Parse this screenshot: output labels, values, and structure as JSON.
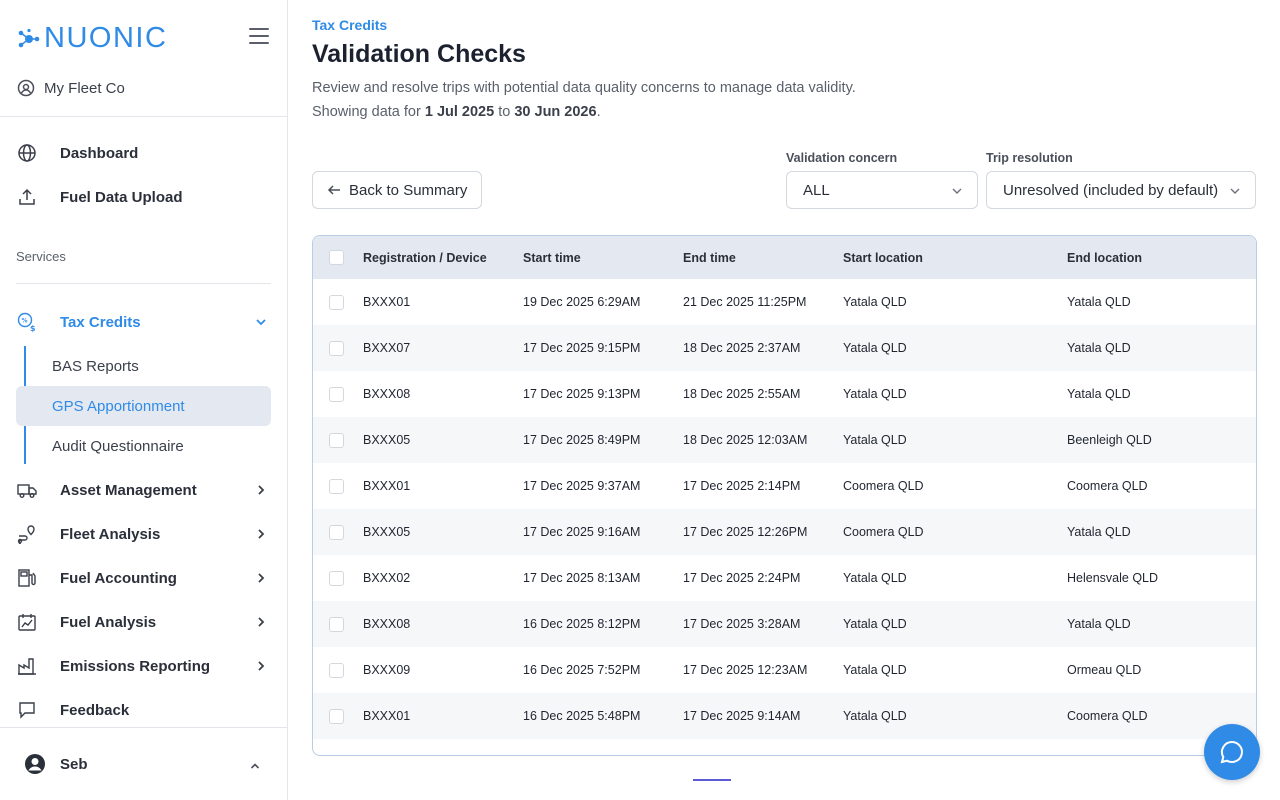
{
  "brand": {
    "name": "NUONIC"
  },
  "org": {
    "name": "My Fleet Co"
  },
  "nav_top": [
    {
      "label": "Dashboard",
      "icon": "globe-icon"
    },
    {
      "label": "Fuel Data Upload",
      "icon": "upload-icon"
    }
  ],
  "services_label": "Services",
  "tax_credits": {
    "label": "Tax Credits",
    "icon": "tax-credits-icon",
    "children": [
      {
        "label": "BAS Reports",
        "selected": false
      },
      {
        "label": "GPS Apportionment",
        "selected": true
      },
      {
        "label": "Audit Questionnaire",
        "selected": false
      }
    ]
  },
  "nav_services": [
    {
      "label": "Asset Management",
      "icon": "truck-icon"
    },
    {
      "label": "Fleet Analysis",
      "icon": "route-pin-icon"
    },
    {
      "label": "Fuel Accounting",
      "icon": "fuel-pump-icon"
    },
    {
      "label": "Fuel Analysis",
      "icon": "calendar-chart-icon"
    },
    {
      "label": "Emissions Reporting",
      "icon": "factory-icon"
    }
  ],
  "feedback": {
    "label": "Feedback",
    "icon": "chat-bubble-icon"
  },
  "user": {
    "name": "Seb"
  },
  "page": {
    "breadcrumb": "Tax Credits",
    "title": "Validation Checks",
    "description": "Review and resolve trips with potential data quality concerns to manage data validity.",
    "showing_prefix": "Showing data for ",
    "date_from": "1 Jul 2025",
    "showing_to": " to ",
    "date_to": "30 Jun 2026",
    "showing_suffix": "."
  },
  "controls": {
    "back_label": "Back to Summary",
    "validation_concern": {
      "label": "Validation concern",
      "value": "ALL"
    },
    "trip_resolution": {
      "label": "Trip resolution",
      "value": "Unresolved (included by default)"
    }
  },
  "table": {
    "columns": [
      "Registration / Device",
      "Start time",
      "End time",
      "Start location",
      "End location"
    ],
    "rows": [
      [
        "BXXX01",
        "19 Dec 2025 6:29AM",
        "21 Dec 2025 11:25PM",
        "Yatala QLD",
        "Yatala QLD"
      ],
      [
        "BXXX07",
        "17 Dec 2025 9:15PM",
        "18 Dec 2025 2:37AM",
        "Yatala QLD",
        "Yatala QLD"
      ],
      [
        "BXXX08",
        "17 Dec 2025 9:13PM",
        "18 Dec 2025 2:55AM",
        "Yatala QLD",
        "Yatala QLD"
      ],
      [
        "BXXX05",
        "17 Dec 2025 8:49PM",
        "18 Dec 2025 12:03AM",
        "Yatala QLD",
        "Beenleigh QLD"
      ],
      [
        "BXXX01",
        "17 Dec 2025 9:37AM",
        "17 Dec 2025 2:14PM",
        "Coomera QLD",
        "Coomera QLD"
      ],
      [
        "BXXX05",
        "17 Dec 2025 9:16AM",
        "17 Dec 2025 12:26PM",
        "Coomera QLD",
        "Yatala QLD"
      ],
      [
        "BXXX02",
        "17 Dec 2025 8:13AM",
        "17 Dec 2025 2:24PM",
        "Yatala QLD",
        "Helensvale QLD"
      ],
      [
        "BXXX08",
        "16 Dec 2025 8:12PM",
        "17 Dec 2025 3:28AM",
        "Yatala QLD",
        "Yatala QLD"
      ],
      [
        "BXXX09",
        "16 Dec 2025 7:52PM",
        "17 Dec 2025 12:23AM",
        "Yatala QLD",
        "Ormeau QLD"
      ],
      [
        "BXXX01",
        "16 Dec 2025 5:48PM",
        "17 Dec 2025 9:14AM",
        "Yatala QLD",
        "Coomera QLD"
      ]
    ]
  },
  "colors": {
    "accent": "#2f8be6",
    "header_bg": "#e4e9f1",
    "selected_bg": "#e4e9f1"
  }
}
